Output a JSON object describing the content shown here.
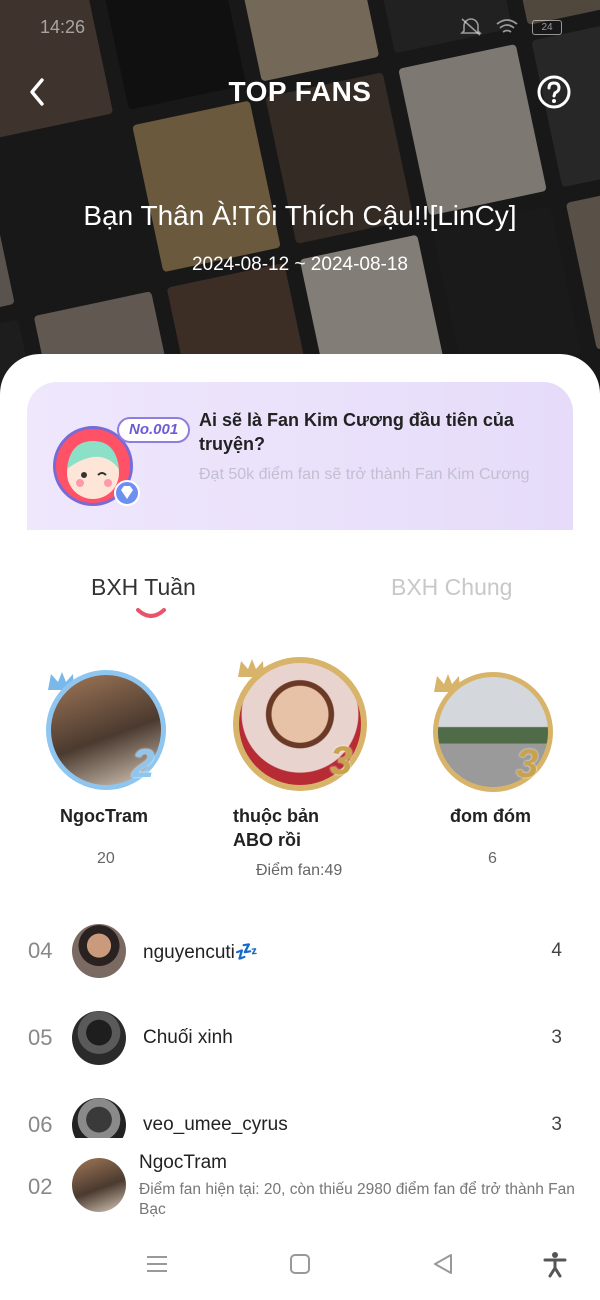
{
  "status_bar": {
    "time": "14:26",
    "battery": "24"
  },
  "header": {
    "title": "TOP FANS",
    "story_title": "Bạn Thân À!Tôi Thích Cậu!![LinCy]",
    "date_range": "2024-08-12 ~ 2024-08-18"
  },
  "banner": {
    "badge": "No.001",
    "heading": "Ai sẽ là Fan Kim Cương đầu tiên của truyện?",
    "subtext": "Đạt 50k điểm fan sẽ trở thành Fan Kim Cương"
  },
  "tabs": {
    "weekly": "BXH Tuần",
    "overall": "BXH Chung"
  },
  "podium": [
    {
      "name": "NgocTram",
      "score": "20",
      "rank_glyph": "2"
    },
    {
      "name": "thuộc bản ABO rồi",
      "score": "Điểm fan:49",
      "rank_glyph": "3"
    },
    {
      "name": "đom đóm",
      "score": "6",
      "rank_glyph": "3"
    }
  ],
  "list": [
    {
      "rank": "04",
      "name": "nguyencuti💤",
      "score": "4"
    },
    {
      "rank": "05",
      "name": "Chuối xinh",
      "score": "3"
    },
    {
      "rank": "06",
      "name": "veo_umee_cyrus",
      "score": "3"
    }
  ],
  "me": {
    "rank": "02",
    "name": "NgocTram",
    "description": "Điểm fan hiện tại: 20, còn thiếu 2980 điểm fan để trở thành Fan Bạc"
  },
  "icons": {
    "back": "chevron-left-icon",
    "help": "question-circle-icon",
    "menu": "menu-icon",
    "home": "square-icon",
    "navback": "triangle-back-icon",
    "accessibility": "accessibility-icon"
  },
  "colors": {
    "accent": "#e9546b",
    "banner_bg": "#ebe2fb",
    "silver": "#8ec6f0",
    "gold": "#d8b46a"
  }
}
